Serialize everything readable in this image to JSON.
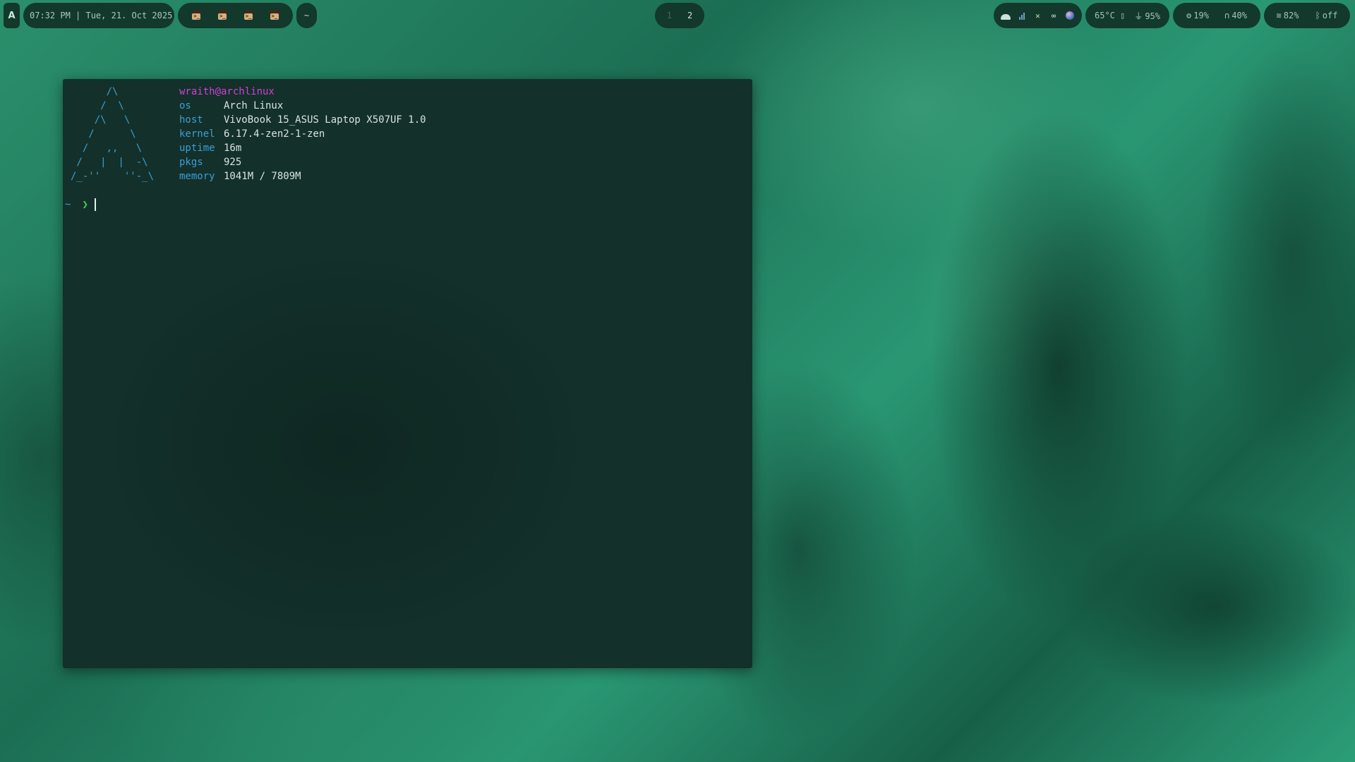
{
  "bar": {
    "launcher_glyph": "A",
    "clock": "07:32 PM | Tue, 21. Oct 2025",
    "apps": [
      {
        "icon": "terminal-app-icon",
        "prompt": ">_"
      },
      {
        "icon": "terminal-app-icon",
        "prompt": ">_"
      },
      {
        "icon": "terminal-app-icon",
        "prompt": ">_"
      },
      {
        "icon": "terminal-app-icon",
        "prompt": ">_"
      }
    ],
    "cwd": "~",
    "workspaces": [
      "1",
      "2"
    ],
    "active_workspace": "2",
    "tray_icons": [
      "cloud-icon",
      "signal-bars-icon",
      "tools-icon",
      "infinity-icon",
      "globe-icon"
    ],
    "temperature": "65°C",
    "battery_glyph": "▯",
    "plug_glyph": "⏚",
    "battery": "95%",
    "cpu_glyph": "⚙",
    "cpu": "19%",
    "headphone_glyph": "∩",
    "volume": "40%",
    "wifi_glyph": "≋",
    "wifi": "82%",
    "bluetooth_glyph": "ᛒ",
    "bluetooth": "off"
  },
  "terminal": {
    "logo": "      /\\\n     /  \\\n    /\\   \\\n   /      \\\n  /   ,,   \\\n /   |  |  -\\\n/_-''    ''-_\\",
    "user_host": "wraith@archlinux",
    "info": [
      {
        "key": "os",
        "value": "Arch Linux"
      },
      {
        "key": "host",
        "value": "VivoBook 15_ASUS Laptop X507UF 1.0"
      },
      {
        "key": "kernel",
        "value": "6.17.4-zen2-1-zen"
      },
      {
        "key": "uptime",
        "value": "16m"
      },
      {
        "key": "pkgs",
        "value": "925"
      },
      {
        "key": "memory",
        "value": "1041M / 7809M"
      }
    ],
    "prompt_dir": "~",
    "prompt_arrow": "❯"
  },
  "colors": {
    "bar_bg": "#13382c",
    "terminal_bg": "#13302a",
    "user_host": "#d43fd6",
    "key": "#3aa0d8",
    "prompt_arrow": "#46d648"
  }
}
